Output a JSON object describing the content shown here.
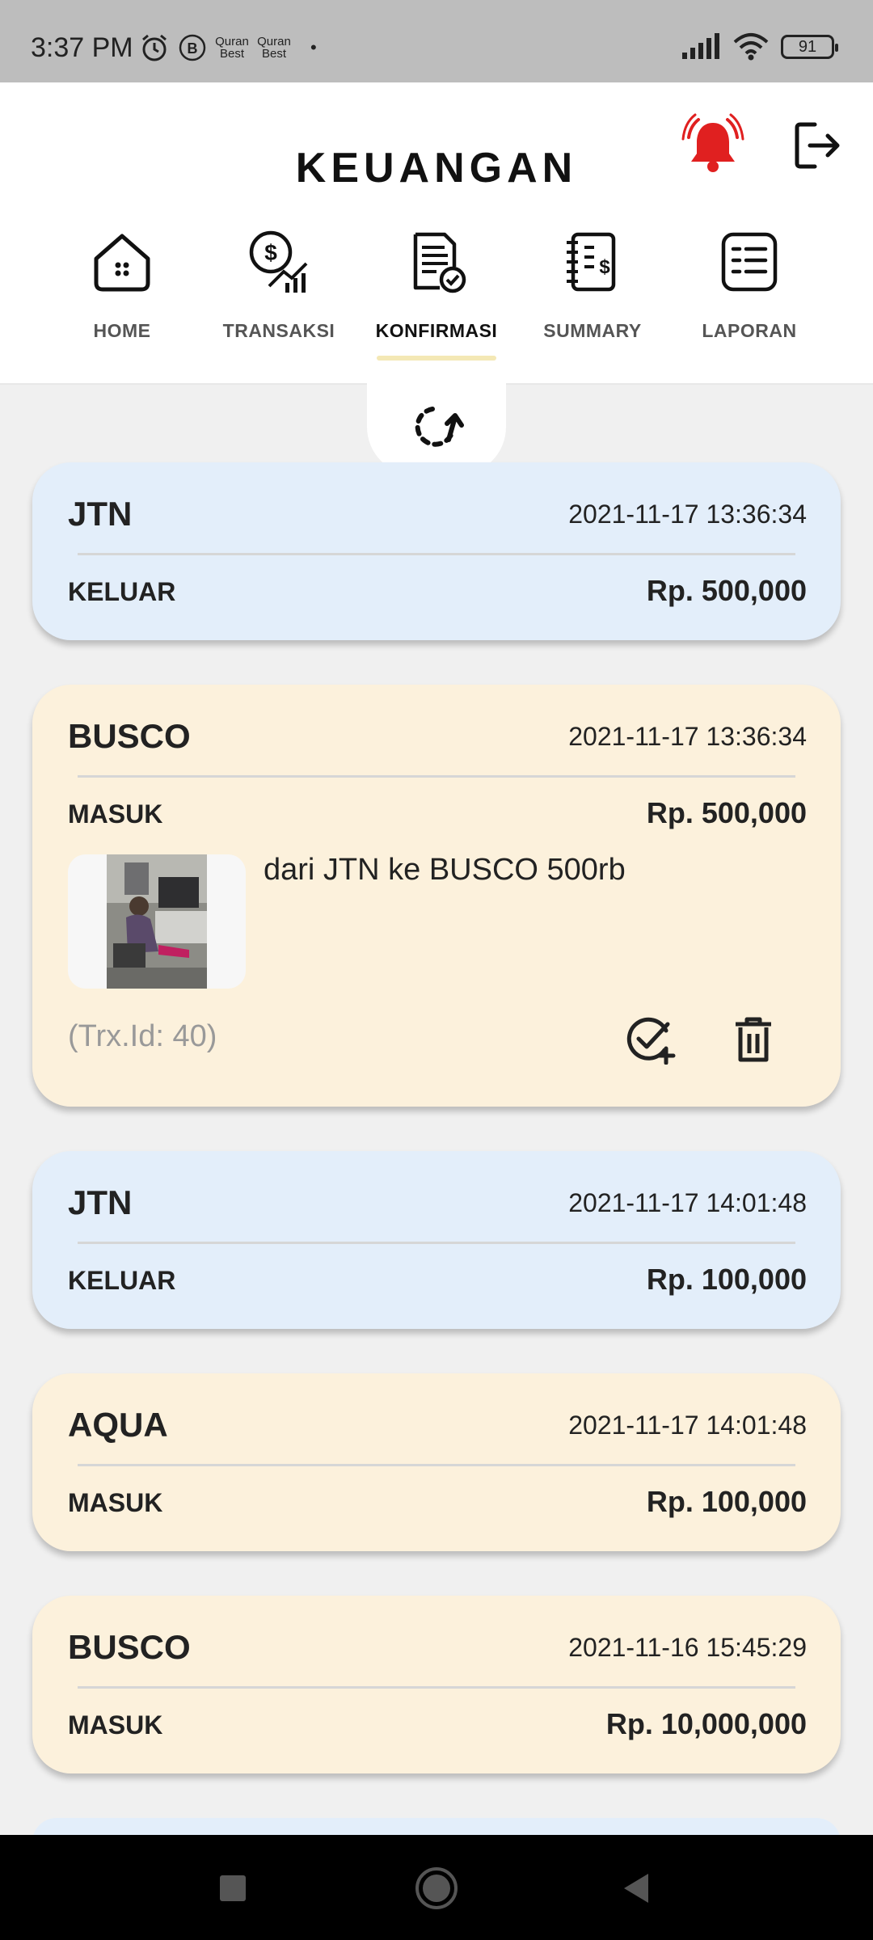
{
  "status_bar": {
    "time": "3:37 PM",
    "app_badge_1": "Quran Best",
    "app_badge_2": "Quran Best",
    "dot": "•",
    "battery": "91"
  },
  "header": {
    "title": "KEUANGAN"
  },
  "nav": {
    "active_index": 2,
    "items": [
      {
        "label": "HOME",
        "icon": "home-icon"
      },
      {
        "label": "TRANSAKSI",
        "icon": "transaction-icon"
      },
      {
        "label": "KONFIRMASI",
        "icon": "confirm-document-icon"
      },
      {
        "label": "SUMMARY",
        "icon": "summary-icon"
      },
      {
        "label": "LAPORAN",
        "icon": "report-icon"
      }
    ]
  },
  "colors": {
    "keluar_card": "#e3eefa",
    "masuk_card": "#fcf1dc",
    "bell": "#e02020",
    "active_underline": "#f4e8b5"
  },
  "transactions": [
    {
      "name": "JTN",
      "datetime": "2021-11-17 13:36:34",
      "type": "KELUAR",
      "amount": "Rp. 500,000"
    },
    {
      "name": "BUSCO",
      "datetime": "2021-11-17 13:36:34",
      "type": "MASUK",
      "amount": "Rp. 500,000",
      "note": "dari JTN ke BUSCO 500rb",
      "trx": "(Trx.Id: 40)"
    },
    {
      "name": "JTN",
      "datetime": "2021-11-17 14:01:48",
      "type": "KELUAR",
      "amount": "Rp. 100,000"
    },
    {
      "name": "AQUA",
      "datetime": "2021-11-17 14:01:48",
      "type": "MASUK",
      "amount": "Rp. 100,000"
    },
    {
      "name": "BUSCO",
      "datetime": "2021-11-16 15:45:29",
      "type": "MASUK",
      "amount": "Rp. 10,000,000"
    }
  ]
}
